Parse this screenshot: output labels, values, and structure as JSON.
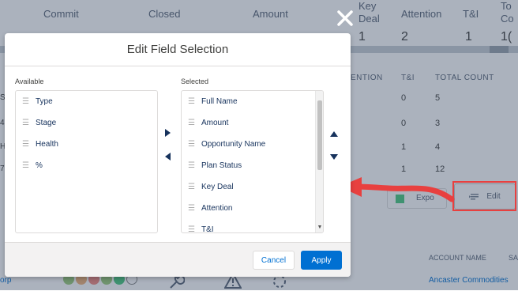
{
  "background": {
    "header_cols": [
      "Commit",
      "Closed",
      "Amount",
      "Key\nDeal",
      "Attention",
      "T&I",
      "To\nCo"
    ],
    "header_vals": [
      "1",
      "2",
      "1",
      "1("
    ],
    "table_headers": [
      "ENTION",
      "T&I",
      "TOTAL COUNT"
    ],
    "table_rows": [
      {
        "ti": "0",
        "count": "5"
      },
      {
        "ti": "0",
        "count": "3"
      },
      {
        "ti": "1",
        "count": "4"
      },
      {
        "ti": "1",
        "count": "12"
      }
    ],
    "left_fragments": [
      "Se",
      "4",
      "Hi",
      "7"
    ],
    "export_label": "Expo",
    "edit_label": "Edit",
    "footer_headers": [
      "ACCOUNT NAME",
      "SA"
    ],
    "footer_left": "orp",
    "footer_account": "Ancaster Commodities",
    "status_dot_colors": [
      "#9bcb7c",
      "#f0b27a",
      "#f28b82",
      "#9bcb7c",
      "#4bca81",
      "#ffffff"
    ]
  },
  "modal": {
    "title": "Edit Field Selection",
    "available_label": "Available",
    "selected_label": "Selected",
    "available_items": [
      "Type",
      "Stage",
      "Health",
      "%"
    ],
    "selected_items": [
      "Full Name",
      "Amount",
      "Opportunity Name",
      "Plan Status",
      "Key Deal",
      "Attention",
      "T&I"
    ],
    "cancel_label": "Cancel",
    "apply_label": "Apply"
  },
  "icons": {
    "close": "close-icon",
    "move_right": "arrow-right-icon",
    "move_left": "arrow-left-icon",
    "move_up": "arrow-up-icon",
    "move_down": "arrow-down-icon",
    "grip": "drag-handle-icon"
  },
  "colors": {
    "brand": "#0070d2",
    "annotation": "#e8403f",
    "overlay": "#2d3e5a"
  }
}
